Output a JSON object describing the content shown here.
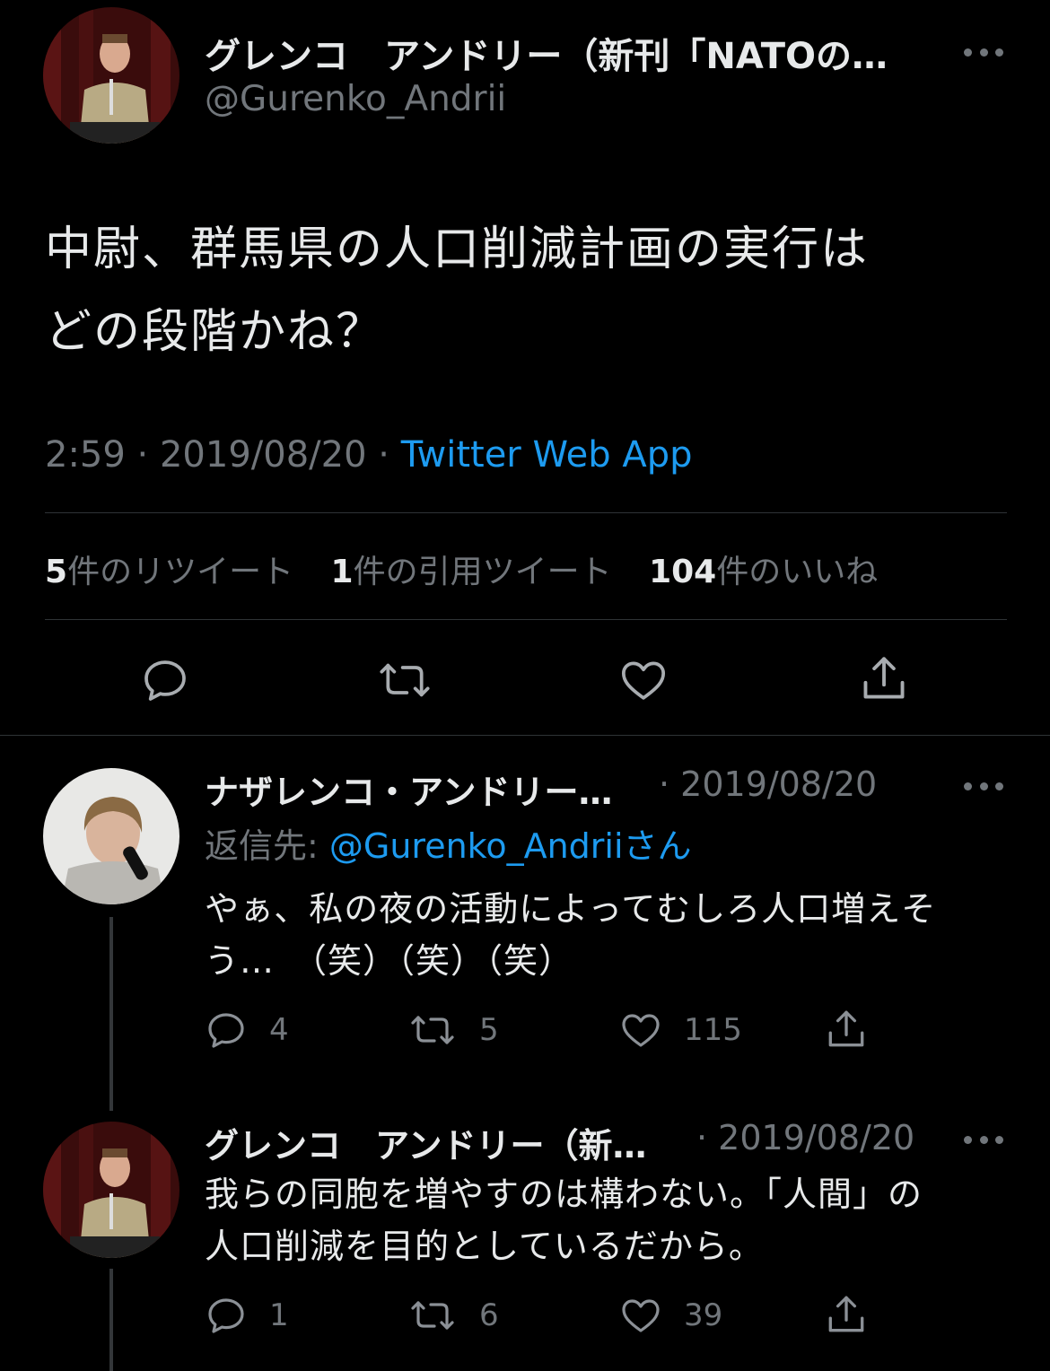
{
  "main_tweet": {
    "author_name": "グレンコ　アンドリー（新刊「NATOの…",
    "handle": "@Gurenko_Andrii",
    "text_lines": [
      "中尉、群馬県の人口削減計画の実行は",
      "どの段階かね？"
    ],
    "time": "2:59",
    "separator": " · ",
    "date": "2019/08/20",
    "source": "Twitter Web App",
    "stats": {
      "retweets_count": "5",
      "retweets_label": "件のリツイート",
      "quotes_count": "1",
      "quotes_label": "件の引用ツイート",
      "likes_count": "104",
      "likes_label": "件のいいね"
    },
    "actions": [
      "reply-icon",
      "retweet-icon",
      "like-icon",
      "share-icon"
    ]
  },
  "replies": [
    {
      "author_name": "ナザレンコ・アンドリー…",
      "date": "· 2019/08/20",
      "reply_to_label": "返信先: ",
      "reply_to_mention": "@Gurenko_Andriiさん",
      "text_lines": [
        "やぁ、私の夜の活動によってむしろ人口増えそ",
        "う…　（笑）（笑）（笑）"
      ],
      "reply_count": "4",
      "retweet_count": "5",
      "like_count": "115"
    },
    {
      "author_name": "グレンコ　アンドリー（新…",
      "date": "· 2019/08/20",
      "text_lines": [
        "我らの同胞を増やすのは構わない。「人間」の",
        "人口削減を目的としているだから。"
      ],
      "reply_count": "1",
      "retweet_count": "6",
      "like_count": "39"
    }
  ],
  "colors": {
    "background": "#000000",
    "text": "#e7e9ea",
    "muted": "#71767b",
    "link": "#1d9bf0",
    "divider": "#2f3336"
  }
}
